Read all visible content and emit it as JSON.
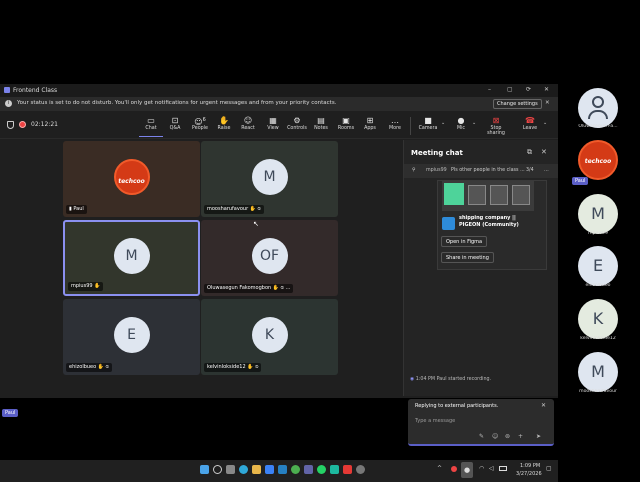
{
  "window": {
    "title": "Frontend Class",
    "controls": [
      "–",
      "▢",
      "⟳",
      "▢",
      "✕"
    ]
  },
  "banner": {
    "text": "Your status is set to do not disturb. You'll only get notifications for urgent messages and from your priority contacts.",
    "button": "Change settings",
    "close": "✕"
  },
  "toolbar": {
    "timer": "02:12:21",
    "items": [
      {
        "label": "Chat",
        "icon": "chat-icon",
        "glyph": "▭"
      },
      {
        "label": "Q&A",
        "icon": "qa-icon",
        "glyph": "⊡"
      },
      {
        "label": "People",
        "icon": "people-icon",
        "glyph": "☺",
        "count": "6"
      },
      {
        "label": "Raise",
        "icon": "hand-icon",
        "glyph": "✋"
      },
      {
        "label": "React",
        "icon": "react-icon",
        "glyph": "☺"
      },
      {
        "label": "View",
        "icon": "view-icon",
        "glyph": "▦"
      },
      {
        "label": "Controls",
        "icon": "controls-icon",
        "glyph": "⚙"
      },
      {
        "label": "Notes",
        "icon": "notes-icon",
        "glyph": "▤"
      },
      {
        "label": "Rooms",
        "icon": "rooms-icon",
        "glyph": "▣"
      },
      {
        "label": "Apps",
        "icon": "apps-icon",
        "glyph": "⊞"
      },
      {
        "label": "More",
        "icon": "more-icon",
        "glyph": "…"
      }
    ],
    "camera": "Camera",
    "mic": "Mic",
    "stop_sharing": "Stop sharing",
    "leave": "Leave"
  },
  "participants": [
    {
      "name": "Paul",
      "initials": "",
      "logo": "techcoo",
      "bg": "#3a2c24"
    },
    {
      "name": "moosharufavour",
      "initials": "M",
      "bg": "#2f3530"
    },
    {
      "name": "mpius99",
      "initials": "M",
      "bg": "#32362c",
      "active": true
    },
    {
      "name": "Oluwasegun Fakomogbon",
      "initials": "OF",
      "bg": "#332a2a"
    },
    {
      "name": "ehizolbueo",
      "initials": "E",
      "bg": "#2d3036"
    },
    {
      "name": "kelvinlokside12",
      "initials": "K",
      "bg": "#2c3431"
    }
  ],
  "chat": {
    "title": "Meeting chat",
    "pinned_user": "mpius99",
    "pinned_text": "Pls other people in the class ...",
    "pinned_count": "3/4",
    "card_title": "shipping company || PIGEON (Community)",
    "open_figma": "Open in Figma",
    "share_meeting": "Share in meeting",
    "event_time": "1:04 PM",
    "event_text": "Paul started recording.",
    "reply_label": "Replying to external participants.",
    "placeholder": "Type a message"
  },
  "taskbar": {
    "time": "1:09 PM",
    "date": "3/27/2026"
  },
  "side_participants": [
    {
      "name": "Oluwasegun Fa...",
      "initials": "",
      "kind": "person"
    },
    {
      "name": "Paul",
      "initials": "",
      "kind": "logo"
    },
    {
      "name": "mpius99",
      "initials": "M"
    },
    {
      "name": "ehizolbueo",
      "initials": "E"
    },
    {
      "name": "kelvinlokside12",
      "initials": "K"
    },
    {
      "name": "moosharufavour",
      "initials": "M"
    }
  ],
  "bottom_badge": "Paul",
  "logo_text": "techcoo",
  "colors": {
    "accent": "#5b5fc7",
    "avatar_bg": "#dfe6f0",
    "avatar_text": "#3f4a5a",
    "side_avatar_bg": "#e4ebe0",
    "leave_red": "#c4314b",
    "logo_red": "#d43a16"
  }
}
